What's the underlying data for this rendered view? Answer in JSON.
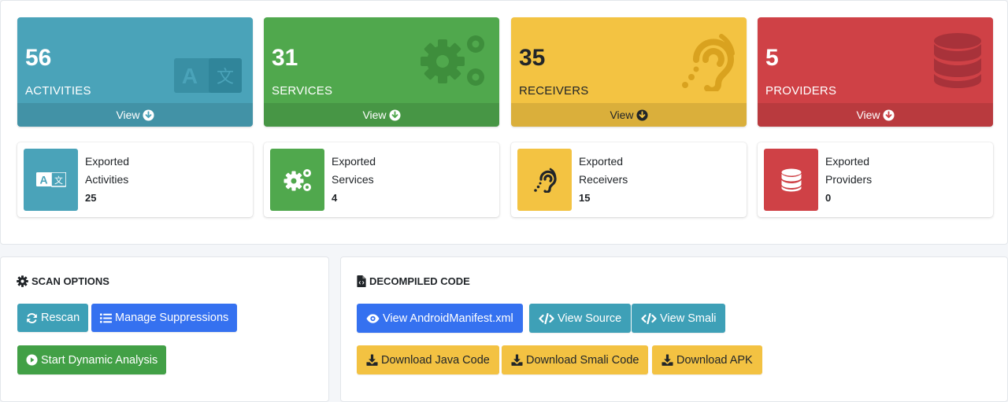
{
  "stats": [
    {
      "count": "56",
      "label": "ACTIVITIES",
      "footer": "View",
      "color": "#4aa3b9",
      "icon": "language-icon"
    },
    {
      "count": "31",
      "label": "SERVICES",
      "footer": "View",
      "color": "#50a84d",
      "icon": "cogs-icon"
    },
    {
      "count": "35",
      "label": "RECEIVERS",
      "footer": "View",
      "color": "#f3c342",
      "icon": "ear-icon"
    },
    {
      "count": "5",
      "label": "PROVIDERS",
      "footer": "View",
      "color": "#cf4146",
      "icon": "database-icon"
    }
  ],
  "exported": [
    {
      "line1": "Exported",
      "line2": "Activities",
      "value": "25",
      "color": "#4aa3b9",
      "icon": "language-icon"
    },
    {
      "line1": "Exported",
      "line2": "Services",
      "value": "4",
      "color": "#50a84d",
      "icon": "cogs-icon"
    },
    {
      "line1": "Exported",
      "line2": "Receivers",
      "value": "15",
      "color": "#f3c342",
      "icon": "ear-icon"
    },
    {
      "line1": "Exported",
      "line2": "Providers",
      "value": "0",
      "color": "#cf4146",
      "icon": "database-icon"
    }
  ],
  "scan_options": {
    "title": "SCAN OPTIONS",
    "rescan": "Rescan",
    "manage_suppressions": "Manage Suppressions",
    "start_dynamic": "Start Dynamic Analysis"
  },
  "decompiled_code": {
    "title": "DECOMPILED CODE",
    "view_manifest": "View AndroidManifest.xml",
    "view_source": "View Source",
    "view_smali": "View Smali",
    "download_java": "Download Java Code",
    "download_smali": "Download Smali Code",
    "download_apk": "Download APK"
  }
}
